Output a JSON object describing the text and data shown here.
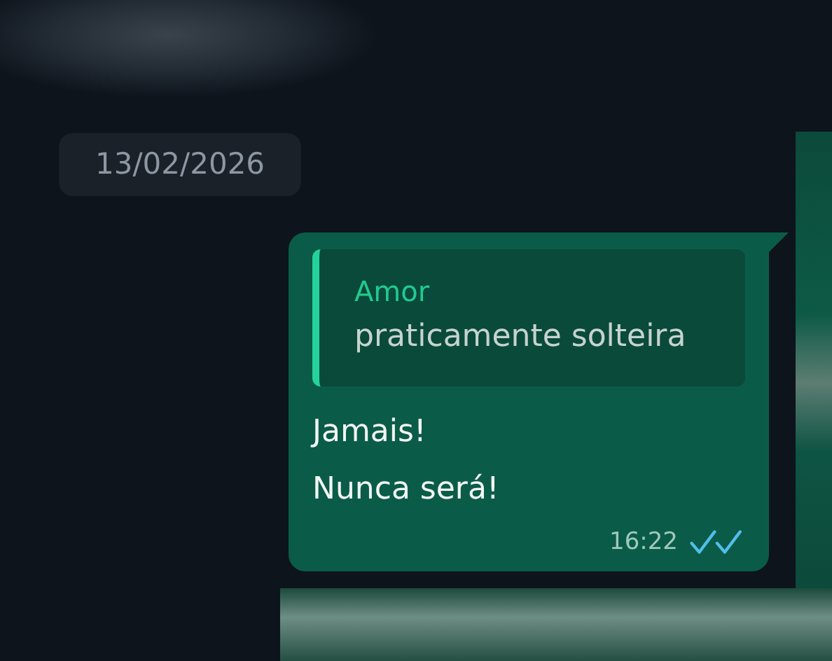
{
  "date_divider": "13/02/2026",
  "message": {
    "outgoing": true,
    "quote": {
      "author": "Amor",
      "text": "praticamente solteira"
    },
    "text": "Jamais!\nNunca será!",
    "time": "16:22",
    "read": true
  }
}
